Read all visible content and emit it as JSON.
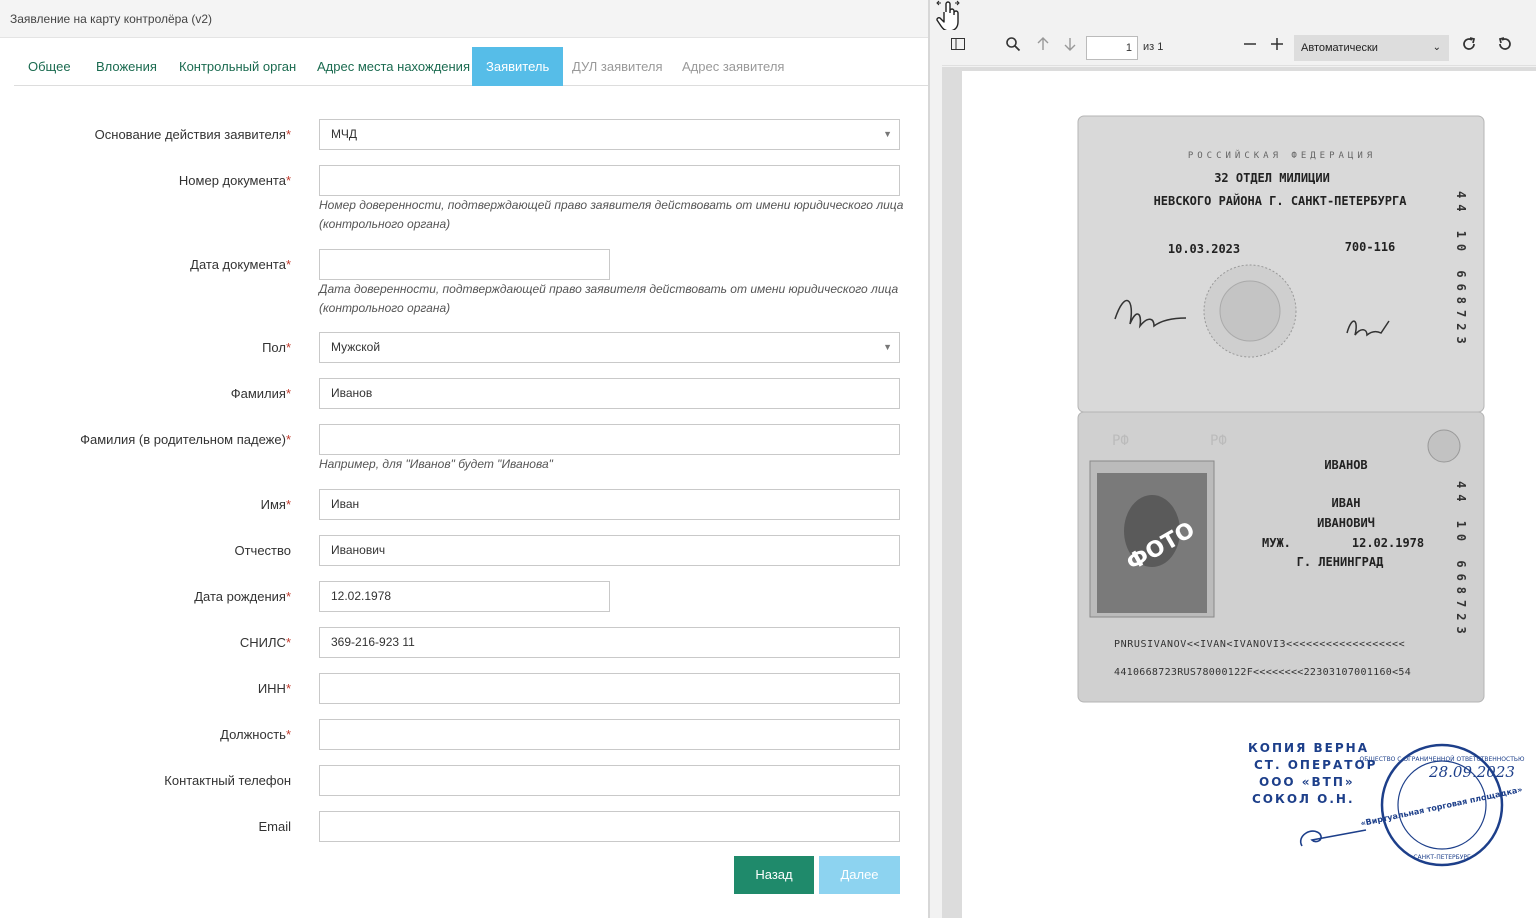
{
  "window": {
    "title": "Заявление на карту контролёра (v2)"
  },
  "tabs": [
    {
      "label": "Общее"
    },
    {
      "label": "Вложения"
    },
    {
      "label": "Контрольный орган"
    },
    {
      "label": "Адрес места нахождения"
    },
    {
      "label": "Заявитель"
    },
    {
      "label": "ДУЛ заявителя"
    },
    {
      "label": "Адрес заявителя"
    }
  ],
  "form": {
    "basis": {
      "label": "Основание действия заявителя",
      "value": "МЧД"
    },
    "doc_number": {
      "label": "Номер документа",
      "value": "",
      "hint": "Номер доверенности, подтверждающей право заявителя действовать от имени юридического лица (контрольного органа)"
    },
    "doc_date": {
      "label": "Дата документа",
      "value": "",
      "hint": "Дата доверенности, подтверждающей право заявителя действовать от имени юридического лица (контрольного органа)"
    },
    "gender": {
      "label": "Пол",
      "value": "Мужской"
    },
    "surname": {
      "label": "Фамилия",
      "value": "Иванов"
    },
    "surname_genitive": {
      "label": "Фамилия (в родительном падеже)",
      "value": "",
      "hint": "Например, для \"Иванов\" будет \"Иванова\""
    },
    "first_name": {
      "label": "Имя",
      "value": "Иван"
    },
    "patronymic": {
      "label": "Отчество",
      "value": "Иванович"
    },
    "birth_date": {
      "label": "Дата рождения",
      "value": "12.02.1978"
    },
    "snils": {
      "label": "СНИЛС",
      "value": "369-216-923 11"
    },
    "inn": {
      "label": "ИНН",
      "value": ""
    },
    "position": {
      "label": "Должность",
      "value": ""
    },
    "phone": {
      "label": "Контактный телефон",
      "value": ""
    },
    "email": {
      "label": "Email",
      "value": ""
    },
    "required_mark": "*"
  },
  "buttons": {
    "back": "Назад",
    "next": "Далее"
  },
  "viewer": {
    "page_number": "1",
    "page_count": "из 1",
    "zoom": "Автоматически",
    "icons": [
      "sidebar-toggle-icon",
      "search-icon",
      "arrow-up-icon",
      "arrow-down-icon",
      "zoom-out-icon",
      "zoom-in-icon",
      "rotate-cw-icon",
      "rotate-ccw-icon",
      "hand-tool-icon"
    ],
    "document": {
      "header": "РОССИЙСКАЯ ФЕДЕРАЦИЯ",
      "issued_by_line1": "32 ОТДЕЛ МИЛИЦИИ",
      "issued_by_line2": "НЕВСКОГО РАЙОНА Г. САНКТ-ПЕТЕРБУРГА",
      "issue_date": "10.03.2023",
      "division_code": "700-116",
      "series_top": "44 10 668723",
      "surname": "ИВАНОВ",
      "name": "ИВАН",
      "patronymic": "ИВАНОВИЧ",
      "sex": "МУЖ.",
      "birth_date": "12.02.1978",
      "birth_place": "Г. ЛЕНИНГРАД",
      "photo_label": "ФОТО",
      "rf_mark": "РФ",
      "mrz1": "PNRUSIVANOV<<IVAN<IVANOVI3<<<<<<<<<<<<<<<<<<",
      "mrz2": "4410668723RUS78000122F<<<<<<<<22303107001160<54",
      "stamp_lines": [
        "КОПИЯ ВЕРНА",
        "СТ. ОПЕРАТОР",
        "ООО «ВТП»",
        "СОКОЛ О.Н."
      ],
      "stamp_date": "28.09.2023",
      "seal_text": "«Виртуальная торговая площадка»",
      "seal_ring": "ОБЩЕСТВО С ОГРАНИЧЕННОЙ ОТВЕТСТВЕННОСТЬЮ",
      "seal_city": "САНКТ-ПЕТЕРБУРГ"
    }
  },
  "colors": {
    "accent": "#56bde8",
    "primary_button": "#1f8a6b",
    "tab_text": "#1b6b50",
    "required": "#c0392b"
  }
}
